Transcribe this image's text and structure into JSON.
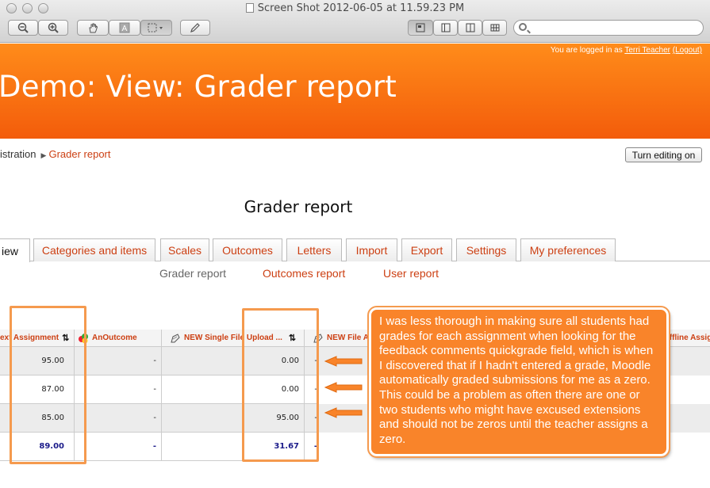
{
  "window": {
    "title": "Screen Shot 2012-06-05 at 11.59.23 PM",
    "search_placeholder": ""
  },
  "header": {
    "login_prefix": "You are logged in as",
    "user_name": "Terri Teacher",
    "logout_label": "(Logout)",
    "page_title": "Demo: View: Grader report"
  },
  "breadcrumb": {
    "items": [
      "istration",
      "Grader report"
    ]
  },
  "turn_editing_label": "Turn editing on",
  "report_heading": "Grader report",
  "tabs": [
    {
      "label": "iew",
      "active": true
    },
    {
      "label": "Categories and items"
    },
    {
      "label": "Scales"
    },
    {
      "label": "Outcomes"
    },
    {
      "label": "Letters"
    },
    {
      "label": "Import"
    },
    {
      "label": "Export"
    },
    {
      "label": "Settings"
    },
    {
      "label": "My preferences"
    }
  ],
  "subtabs": [
    {
      "label": "Grader report",
      "active": true
    },
    {
      "label": "Outcomes report"
    },
    {
      "label": "User report"
    }
  ],
  "table": {
    "columns": [
      "ext Assignment",
      "AnOutcome",
      "NEW Single File Upload ...",
      "NEW File A",
      "Offline Assig"
    ],
    "rows": [
      [
        "95.00",
        "-",
        "0.00",
        "-"
      ],
      [
        "87.00",
        "-",
        "0.00",
        "-"
      ],
      [
        "85.00",
        "-",
        "95.00",
        "-"
      ]
    ],
    "average": [
      "89.00",
      "-",
      "31.67",
      "-"
    ]
  },
  "annotation": {
    "text": "I was less thorough in making sure all students had grades for each assignment when looking for the feedback comments quickgrade field, which is when I discovered that if I hadn't entered a grade, Moodle automatically graded submissions for me as a zero.  This could be a problem as often there are one or two students who might have excused extensions and should not be zeros until the teacher assigns a zero."
  },
  "colors": {
    "banner": "#f36b10",
    "link": "#cc3f12",
    "annotation": "#f9842a"
  },
  "icons": {
    "sort": "sort-arrows-icon",
    "outcome": "outcome-icon",
    "assignment": "assignment-icon"
  }
}
